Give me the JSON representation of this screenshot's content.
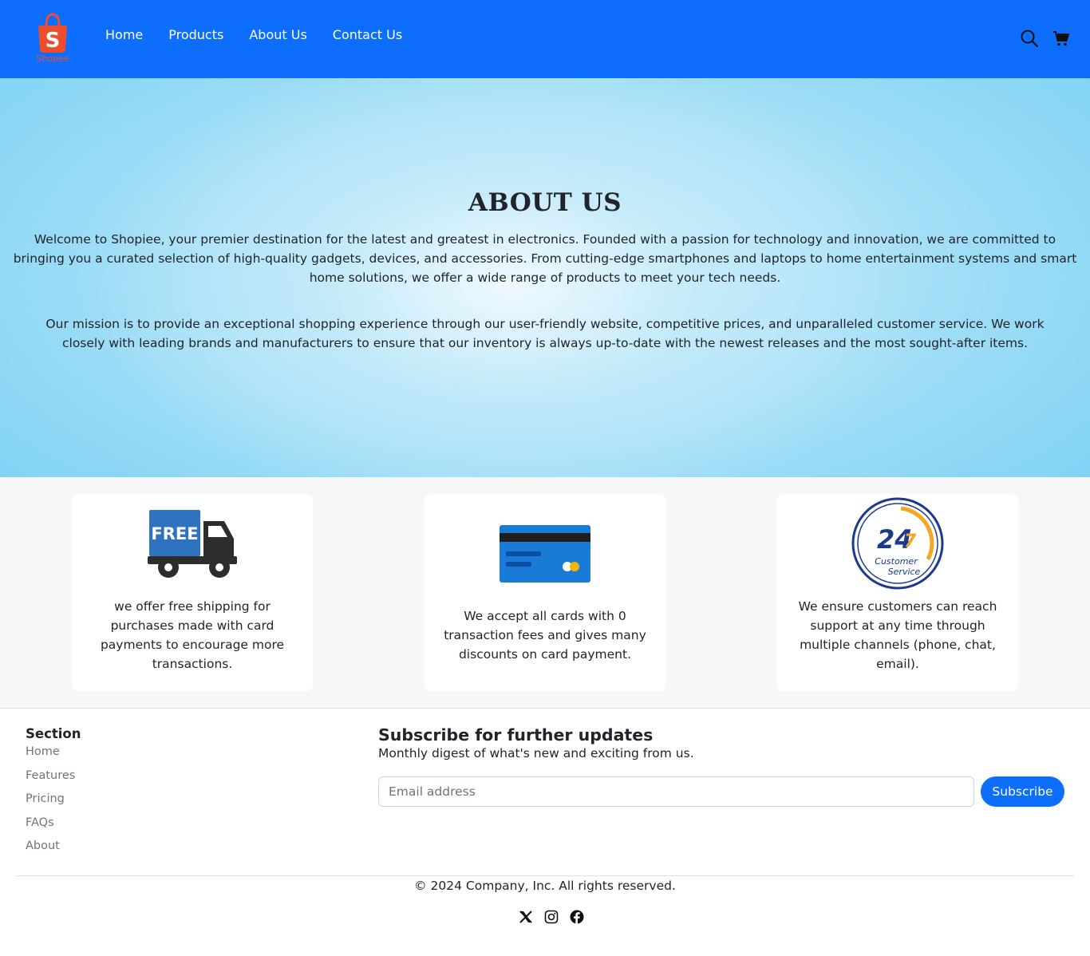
{
  "brand": {
    "name": "Shopee",
    "color": "#ee4d2d"
  },
  "nav": {
    "links": [
      "Home",
      "Products",
      "About Us",
      "Contact Us"
    ],
    "icons": [
      "search-icon",
      "cart-icon"
    ],
    "background": "#0d6efd"
  },
  "hero": {
    "title": "ABOUT US",
    "paragraph1": "Welcome to Shopiee, your premier destination for the latest and greatest in electronics. Founded with a passion for technology and innovation, we are committed to bringing you a curated selection of high-quality gadgets, devices, and accessories. From cutting-edge smartphones and laptops to home entertainment systems and smart home solutions, we offer a wide range of products to meet your tech needs.",
    "paragraph2": "Our mission is to provide an exceptional shopping experience through our user-friendly website, competitive prices, and unparalleled customer service. We work closely with leading brands and manufacturers to ensure that our inventory is always up-to-date with the newest releases and the most sought-after items."
  },
  "features": [
    {
      "icon": "free-shipping-truck-icon",
      "badge": "FREE",
      "text": "we offer free shipping for purchases made with card payments to encourage more transactions."
    },
    {
      "icon": "credit-card-icon",
      "text": "We accept all cards with 0 transaction fees and gives many discounts on card payment."
    },
    {
      "icon": "customer-service-24-7-icon",
      "badge_main": "24",
      "badge_small": "7",
      "badge_text1": "Customer",
      "badge_text2": "Service",
      "text": "We ensure customers can reach support at any time through multiple channels (phone, chat, email)."
    }
  ],
  "footer": {
    "section_title": "Section",
    "links": [
      "Home",
      "Features",
      "Pricing",
      "FAQs",
      "About"
    ],
    "subscribe": {
      "title": "Subscribe for further updates",
      "description": "Monthly digest of what's new and exciting from us.",
      "placeholder": "Email address",
      "button": "Subscribe"
    },
    "copyright": "© 2024 Company, Inc. All rights reserved.",
    "social_icons": [
      "x-twitter-icon",
      "instagram-icon",
      "facebook-icon"
    ]
  }
}
